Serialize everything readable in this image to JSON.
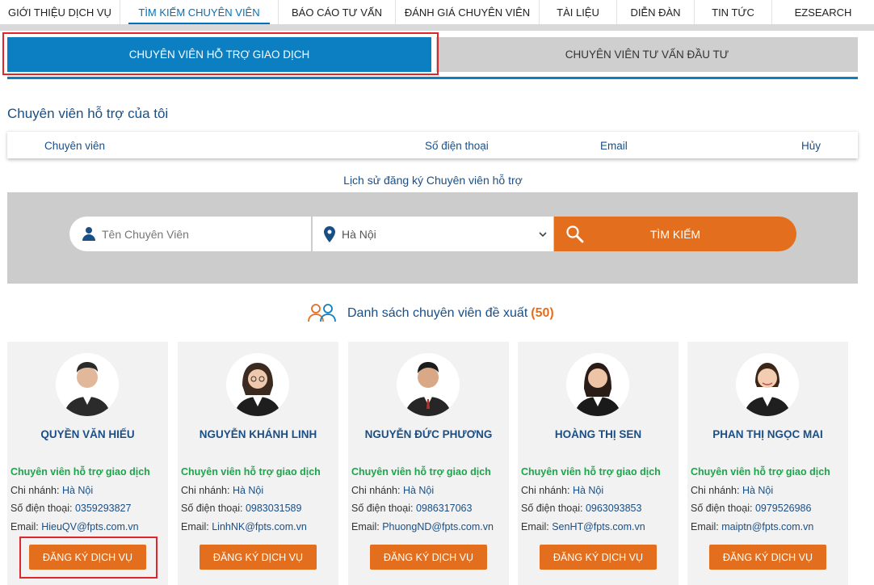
{
  "nav": {
    "items": [
      {
        "label": "GIỚI THIỆU DỊCH VỤ"
      },
      {
        "label": "TÌM KIẾM CHUYÊN VIÊN"
      },
      {
        "label": "BÁO CÁO TƯ VẤN"
      },
      {
        "label": "ĐÁNH GIÁ CHUYÊN VIÊN"
      },
      {
        "label": "TÀI LIỆU"
      },
      {
        "label": "DIỄN ĐÀN"
      },
      {
        "label": "TIN TỨC"
      },
      {
        "label": "EZSEARCH"
      }
    ],
    "active": "TÌM KIẾM CHUYÊN VIÊN"
  },
  "tabs": {
    "trading_support": "CHUYÊN VIÊN HỖ TRỢ GIAO DỊCH",
    "investment_advisor": "CHUYÊN VIÊN TƯ VẤN ĐẦU TƯ"
  },
  "my_support": {
    "title": "Chuyên viên hỗ trợ của tôi",
    "columns": {
      "specialist": "Chuyên viên",
      "phone": "Số điện thoại",
      "email": "Email",
      "cancel": "Hủy"
    }
  },
  "history_link": "Lịch sử đăng ký Chuyên viên hỗ trợ",
  "search": {
    "name_placeholder": "Tên Chuyên Viên",
    "city_value": "Hà Nội",
    "button_label": "TÌM KIẾM"
  },
  "recommended": {
    "title": "Danh sách chuyên viên đề xuất",
    "count": "(50)"
  },
  "card_labels": {
    "branch": "Chi nhánh:",
    "phone": "Số điện thoại:",
    "email": "Email:",
    "register": "ĐĂNG KÝ DỊCH VỤ"
  },
  "cards": [
    {
      "name": "QUYỀN VĂN HIẾU",
      "role": "Chuyên viên hỗ trợ giao dịch",
      "branch": "Hà Nội",
      "phone": "0359293827",
      "email": "HieuQV@fpts.com.vn"
    },
    {
      "name": "NGUYỄN KHÁNH LINH",
      "role": "Chuyên viên hỗ trợ giao dịch",
      "branch": "Hà Nội",
      "phone": "0983031589",
      "email": "LinhNK@fpts.com.vn"
    },
    {
      "name": "NGUYỄN ĐỨC PHƯƠNG",
      "role": "Chuyên viên hỗ trợ giao dịch",
      "branch": "Hà Nội",
      "phone": "0986317063",
      "email": "PhuongND@fpts.com.vn"
    },
    {
      "name": "HOÀNG THỊ SEN",
      "role": "Chuyên viên hỗ trợ giao dịch",
      "branch": "Hà Nội",
      "phone": "0963093853",
      "email": "SenHT@fpts.com.vn"
    },
    {
      "name": "PHAN THỊ NGỌC MAI",
      "role": "Chuyên viên hỗ trợ giao dịch",
      "branch": "Hà Nội",
      "phone": "0979526986",
      "email": "maiptn@fpts.com.vn"
    }
  ],
  "colors": {
    "primary_blue": "#0b7fc1",
    "text_blue": "#1a4f86",
    "accent_orange": "#e36f1e",
    "role_green": "#1aa64a",
    "highlight_red": "#e0262b"
  }
}
